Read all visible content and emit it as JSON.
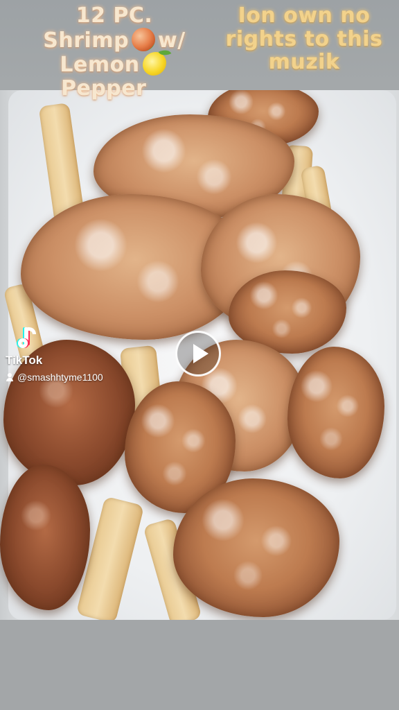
{
  "caption_left": {
    "line1": "12 PC.",
    "line2_text": "Shrimp",
    "line2_suffix": "w/",
    "line3_text": "Lemon",
    "line4": "Pepper",
    "icons": [
      "shrimp-emoji-icon",
      "lemon-emoji-icon"
    ],
    "color": "#f7e7cf"
  },
  "caption_right": {
    "line1": "Ion own no",
    "line2": "rights to this",
    "line3": "muzik",
    "color": "#f2d28c"
  },
  "watermark": {
    "brand": "TikTok",
    "username": "@smashhtyme1100",
    "icons": [
      "tiktok-logo-icon",
      "user-icon"
    ]
  },
  "player": {
    "icon": "play-icon"
  },
  "colors": {
    "background": "#a3a6a8",
    "tray": "#f1f2f4",
    "shrimp": "#bd7b4f"
  }
}
